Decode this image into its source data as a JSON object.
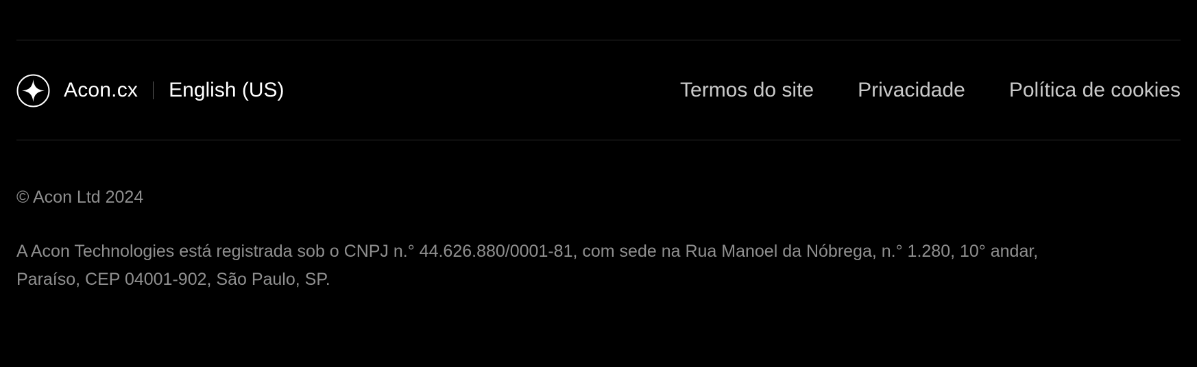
{
  "brand": {
    "logo_icon": "four-point-star-icon",
    "name": "Acon.cx",
    "language": "English (US)"
  },
  "links": [
    {
      "label": "Termos do site"
    },
    {
      "label": "Privacidade"
    },
    {
      "label": "Política de cookies"
    }
  ],
  "footer": {
    "copyright": "© Acon Ltd 2024",
    "legal_line_1": "A Acon Technologies está registrada sob o CNPJ n.° 44.626.880/0001-81, com sede na Rua Manoel da Nóbrega, n.° 1.280, 10° andar,",
    "legal_line_2": "Paraíso, CEP 04001-902, São Paulo, SP."
  },
  "colors": {
    "background": "#000000",
    "primary_text": "#ffffff",
    "link_text": "#c9c9c9",
    "muted_text": "#8f8f8f",
    "divider": "#2b2b2b"
  }
}
